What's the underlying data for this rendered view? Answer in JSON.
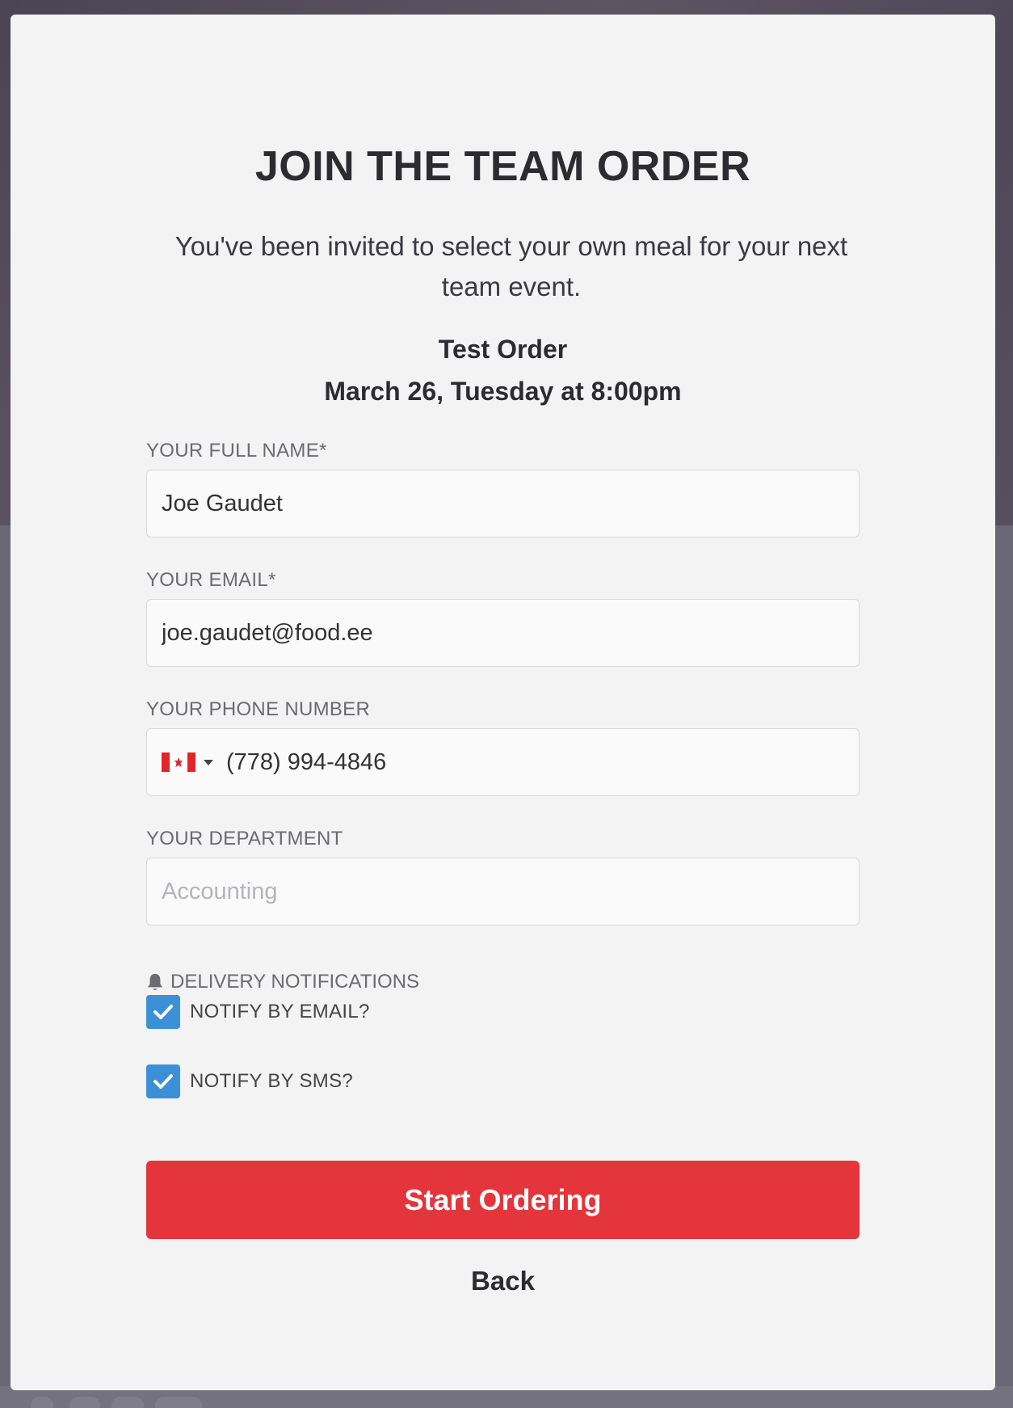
{
  "modal": {
    "title": "JOIN THE TEAM ORDER",
    "intro": "You've been invited to select your own meal for your next team event.",
    "order_name": "Test Order",
    "order_date": "March 26, Tuesday at 8:00pm"
  },
  "form": {
    "full_name": {
      "label": "YOUR FULL NAME*",
      "value": "Joe Gaudet"
    },
    "email": {
      "label": "YOUR EMAIL*",
      "value": "joe.gaudet@food.ee"
    },
    "phone": {
      "label": "YOUR PHONE NUMBER",
      "country": "canada-flag-icon",
      "value": "(778) 994-4846"
    },
    "department": {
      "label": "YOUR DEPARTMENT",
      "placeholder": "Accounting",
      "value": ""
    }
  },
  "notifications": {
    "header": "DELIVERY NOTIFICATIONS",
    "icon": "bell-icon",
    "email": {
      "label": "NOTIFY BY EMAIL?",
      "checked": true
    },
    "sms": {
      "label": "NOTIFY BY SMS?",
      "checked": true
    }
  },
  "actions": {
    "start_label": "Start Ordering",
    "back_label": "Back"
  },
  "colors": {
    "primary_button": "#e3353b",
    "checkbox": "#3c91d6",
    "modal_background": "#f3f3f3"
  }
}
